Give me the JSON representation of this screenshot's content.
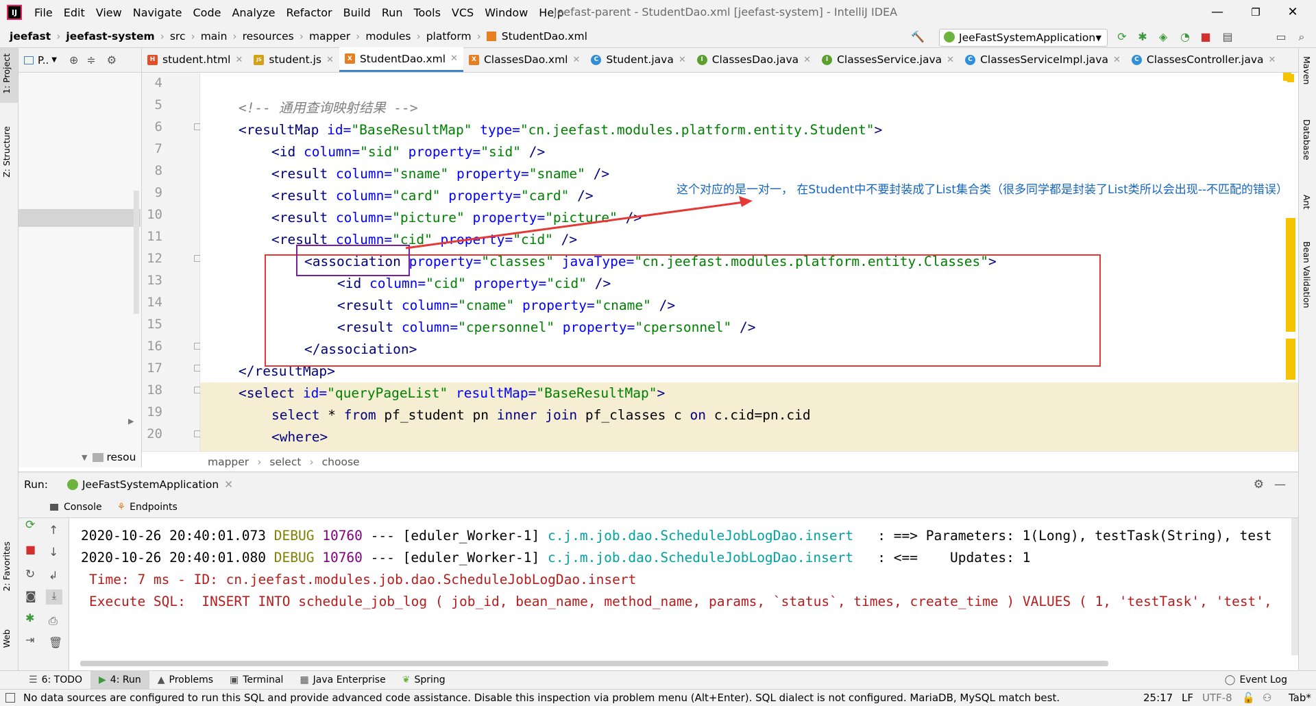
{
  "menubar": {
    "logo": "IJ",
    "items": [
      "File",
      "Edit",
      "View",
      "Navigate",
      "Code",
      "Analyze",
      "Refactor",
      "Build",
      "Run",
      "Tools",
      "VCS",
      "Window",
      "Help"
    ],
    "title": "jeefast-parent - StudentDao.xml [jeefast-system] - IntelliJ IDEA"
  },
  "navbar": {
    "crumbs": [
      "jeefast",
      "jeefast-system",
      "src",
      "main",
      "resources",
      "mapper",
      "modules",
      "platform",
      "StudentDao.xml"
    ],
    "run_config": "JeeFastSystemApplication"
  },
  "left_strip": {
    "project": "1: Project",
    "structure": "Z: Structure",
    "favorites": "2: Favorites",
    "web": "Web"
  },
  "right_strip": {
    "maven": "Maven",
    "database": "Database",
    "ant": "Ant",
    "bean": "Bean Validation"
  },
  "project_panel": {
    "title": "P..",
    "tree_item": "resou"
  },
  "tabs": [
    {
      "label": "student.html",
      "color": "#e44d26",
      "glyph": "H"
    },
    {
      "label": "student.js",
      "color": "#d4a017",
      "glyph": "JS"
    },
    {
      "label": "StudentDao.xml",
      "color": "#e67e22",
      "glyph": "X",
      "active": true
    },
    {
      "label": "ClassesDao.xml",
      "color": "#e67e22",
      "glyph": "X"
    },
    {
      "label": "Student.java",
      "color": "#2f8fd8",
      "glyph": "C"
    },
    {
      "label": "ClassesDao.java",
      "color": "#5aa02c",
      "glyph": "I"
    },
    {
      "label": "ClassesService.java",
      "color": "#5aa02c",
      "glyph": "I"
    },
    {
      "label": "ClassesServiceImpl.java",
      "color": "#2f8fd8",
      "glyph": "C"
    },
    {
      "label": "ClassesController.java",
      "color": "#2f8fd8",
      "glyph": "C"
    }
  ],
  "line_numbers": [
    "4",
    "5",
    "6",
    "7",
    "8",
    "9",
    "10",
    "11",
    "12",
    "13",
    "14",
    "15",
    "16",
    "17",
    "18",
    "19",
    "20"
  ],
  "code": {
    "l5": "<!-- 通用查询映射结果 -->",
    "l6a": "<resultMap ",
    "l6b": "id=",
    "l6c": "\"BaseResultMap\"",
    "l6d": " type=",
    "l6e": "\"cn.jeefast.modules.platform.entity.Student\"",
    "l6f": ">",
    "l7a": "<id ",
    "l7b": "column=",
    "l7c": "\"sid\"",
    "l7d": " property=",
    "l7e": "\"sid\"",
    "l7f": " />",
    "l8a": "<result ",
    "l8b": "column=",
    "l8c": "\"sname\"",
    "l8d": " property=",
    "l8e": "\"sname\"",
    "l8f": " />",
    "l9a": "<result ",
    "l9b": "column=",
    "l9c": "\"card\"",
    "l9d": " property=",
    "l9e": "\"card\"",
    "l9f": " />",
    "l10a": "<result ",
    "l10b": "column=",
    "l10c": "\"picture\"",
    "l10d": " property=",
    "l10e": "\"picture\"",
    "l10f": " />",
    "l11a": "<result ",
    "l11b": "column=",
    "l11c": "\"cid\"",
    "l11d": " property=",
    "l11e": "\"cid\"",
    "l11f": " />",
    "l12a": "<association",
    "l12b": " property=",
    "l12c": "\"classes\"",
    "l12d": " javaType=",
    "l12e": "\"cn.jeefast.modules.platform.entity.Classes\"",
    "l12f": ">",
    "l13a": "<id ",
    "l13b": "column=",
    "l13c": "\"cid\"",
    "l13d": " property=",
    "l13e": "\"cid\"",
    "l13f": " />",
    "l14a": "<result ",
    "l14b": "column=",
    "l14c": "\"cname\"",
    "l14d": " property=",
    "l14e": "\"cname\"",
    "l14f": " />",
    "l15a": "<result ",
    "l15b": "column=",
    "l15c": "\"cpersonnel\"",
    "l15d": " property=",
    "l15e": "\"cpersonnel\"",
    "l15f": " />",
    "l16": "</association>",
    "l17": "</resultMap>",
    "l18a": "<select ",
    "l18b": "id=",
    "l18c": "\"queryPageList\"",
    "l18d": " resultMap=",
    "l18e": "\"BaseResultMap\"",
    "l18f": ">",
    "l19a": "select",
    "l19b": " * ",
    "l19c": "from",
    "l19d": " pf_student pn ",
    "l19e": "inner join",
    "l19f": " pf_classes c ",
    "l19g": "on",
    "l19h": " c.cid=pn.cid",
    "l20": "<where>"
  },
  "annotation": "这个对应的是一对一， 在Student中不要封装成了List集合类（很多同学都是封装了List类所以会出现--不匹配的错误）",
  "editor_breadcrumb": [
    "mapper",
    "select",
    "choose"
  ],
  "run": {
    "label": "Run:",
    "tab": "JeeFastSystemApplication",
    "console_tab": "Console",
    "endpoints_tab": "Endpoints"
  },
  "console": {
    "l1a": "2020-10-26 20:40:01.073 ",
    "l1b": "DEBUG",
    "l1c": " 10760",
    "l1d": " --- [eduler_Worker-1] ",
    "l1e": "c.j.m.job.dao.ScheduleJobLogDao.insert",
    "l1f": "   : ==> Parameters: 1(Long), testTask(String), test",
    "l2a": "2020-10-26 20:40:01.080 ",
    "l2b": "DEBUG",
    "l2c": " 10760",
    "l2d": " --- [eduler_Worker-1] ",
    "l2e": "c.j.m.job.dao.ScheduleJobLogDao.insert",
    "l2f": "   : <==    Updates: 1",
    "l3": "Time: 7 ms - ID: cn.jeefast.modules.job.dao.ScheduleJobLogDao.insert",
    "l4": "Execute SQL:  INSERT INTO schedule_job_log ( job_id, bean_name, method_name, params, `status`, times, create_time ) VALUES ( 1, 'testTask', 'test',"
  },
  "bottom_tabs": [
    "6: TODO",
    "4: Run",
    "Problems",
    "Terminal",
    "Java Enterprise",
    "Spring"
  ],
  "event_log": "Event Log",
  "status": {
    "message": "No data sources are configured to run this SQL and provide advanced code assistance. Disable this inspection via problem menu (Alt+Enter). SQL dialect is not configured. MariaDB, MySQL match best.",
    "position": "25:17",
    "line_sep": "LF",
    "encoding": "UTF-8",
    "indent": "Tab*"
  },
  "colors": {
    "accent": "#4083c9",
    "highlight": "#f5eed3",
    "red_box": "#e53935",
    "purple_box": "#7b1fa2",
    "annotation": "#1565c0"
  }
}
